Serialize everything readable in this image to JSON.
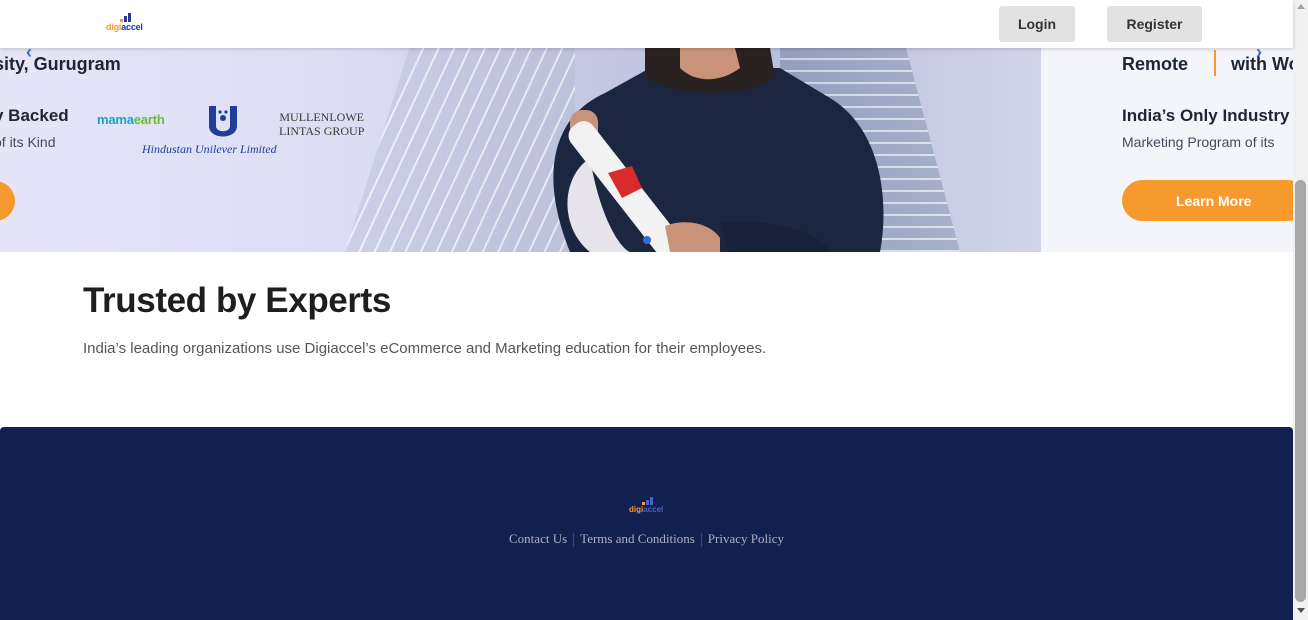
{
  "header": {
    "logo": {
      "part1": "digi",
      "part2": "accel"
    },
    "login_label": "Login",
    "register_label": "Register"
  },
  "hero": {
    "left_slide": {
      "location_text": "sity, Gurugram",
      "backed_text": "y Backed",
      "kind_text": "of its Kind",
      "brands": {
        "mamaearth_a": "mama",
        "mamaearth_b": "earth",
        "hul": "Hindustan Unilever Limited",
        "mullen_line1": "MULLENLOWE",
        "mullen_line2": "LINTAS GROUP"
      }
    },
    "right_slide": {
      "remote_text": "Remote",
      "with_text": "with Wo",
      "only_text": "India’s Only Industry",
      "marketing_text": "Marketing Program of its",
      "learn_more_label": "Learn More"
    }
  },
  "trusted": {
    "title": "Trusted by Experts",
    "subtitle": "India’s leading organizations use Digiaccel’s eCommerce and Marketing education for their employees."
  },
  "footer": {
    "logo": {
      "part1": "digi",
      "part2": "accel"
    },
    "links": [
      "Contact Us",
      "Terms and Conditions",
      "Privacy Policy"
    ]
  },
  "colors": {
    "accent_orange": "#f79a2e",
    "footer_navy": "#12204f",
    "brand_blue": "#2b3a8c"
  }
}
